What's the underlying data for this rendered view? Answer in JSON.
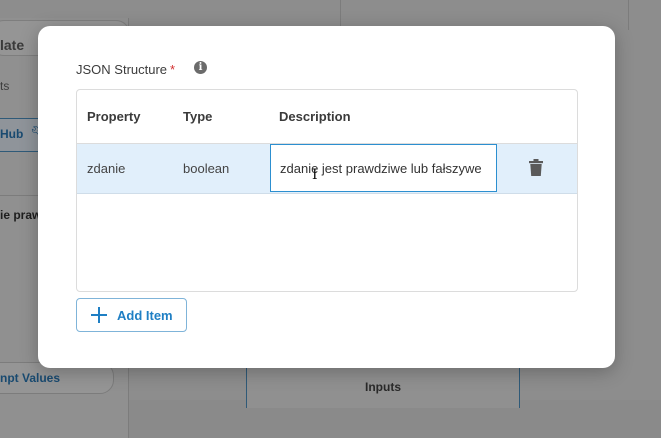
{
  "background": {
    "title": "late",
    "subtitle": "ts",
    "hub_label": "Hub",
    "prompt_text": "ie praw",
    "prompt_values_label": "npt Values",
    "inputs_label": "Inputs"
  },
  "modal": {
    "field_label": "JSON Structure",
    "required_mark": "*",
    "info_icon": "info-icon",
    "table": {
      "headers": {
        "property": "Property",
        "type": "Type",
        "description": "Description"
      },
      "rows": [
        {
          "property": "zdanie",
          "type": "boolean",
          "description": "zdanie jest prawdziwe lub fałszywe"
        }
      ]
    },
    "add_button_label": "Add Item",
    "colors": {
      "accent": "#1f7fc4",
      "row_selected": "#e1effb",
      "required": "#d32f2f"
    }
  }
}
